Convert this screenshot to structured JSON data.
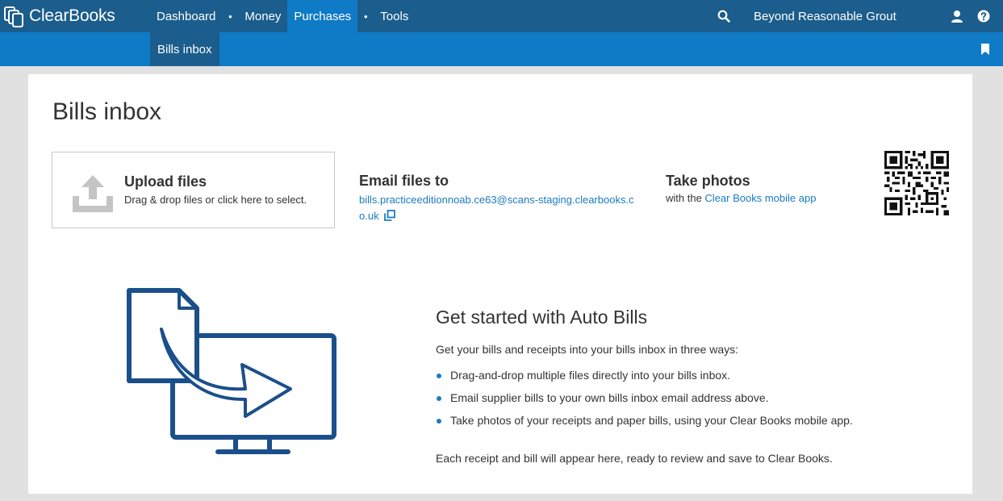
{
  "app": {
    "logo_text": "ClearBooks"
  },
  "nav": {
    "items": [
      {
        "label": "Dashboard"
      },
      {
        "label": "Money"
      },
      {
        "label": "Purchases"
      },
      {
        "label": "Tools"
      }
    ],
    "separator": "•",
    "company": "Beyond Reasonable Grout"
  },
  "subnav": {
    "active_label": "Bills inbox"
  },
  "page": {
    "title": "Bills inbox"
  },
  "upload": {
    "title": "Upload files",
    "subtitle": "Drag & drop files or click here to select."
  },
  "email": {
    "title": "Email files to",
    "address": "bills.practiceeditionnoab.ce63@scans-staging.clearbooks.co.uk"
  },
  "photos": {
    "title": "Take photos",
    "prefix": "with the ",
    "link": "Clear Books mobile app"
  },
  "get_started": {
    "title": "Get started with Auto Bills",
    "intro": "Get your bills and receipts into your bills inbox in three ways:",
    "bullets": [
      "Drag-and-drop multiple files directly into your bills inbox.",
      "Email supplier bills to your own bills inbox email address above.",
      "Take photos of your receipts and paper bills, using your Clear Books mobile app."
    ],
    "footer": "Each receipt and bill will appear here, ready to review and save to Clear Books."
  },
  "icons": {
    "search": "search-icon",
    "user": "user-icon",
    "help": "help-icon",
    "bookmark": "bookmark-icon",
    "upload": "upload-icon",
    "copy": "copy-icon",
    "qr": "qr-code"
  },
  "colors": {
    "topbar": "#1b5d8c",
    "subbar": "#0f7ac6",
    "link": "#1a7bbf",
    "illustration": "#1b4f8a"
  }
}
